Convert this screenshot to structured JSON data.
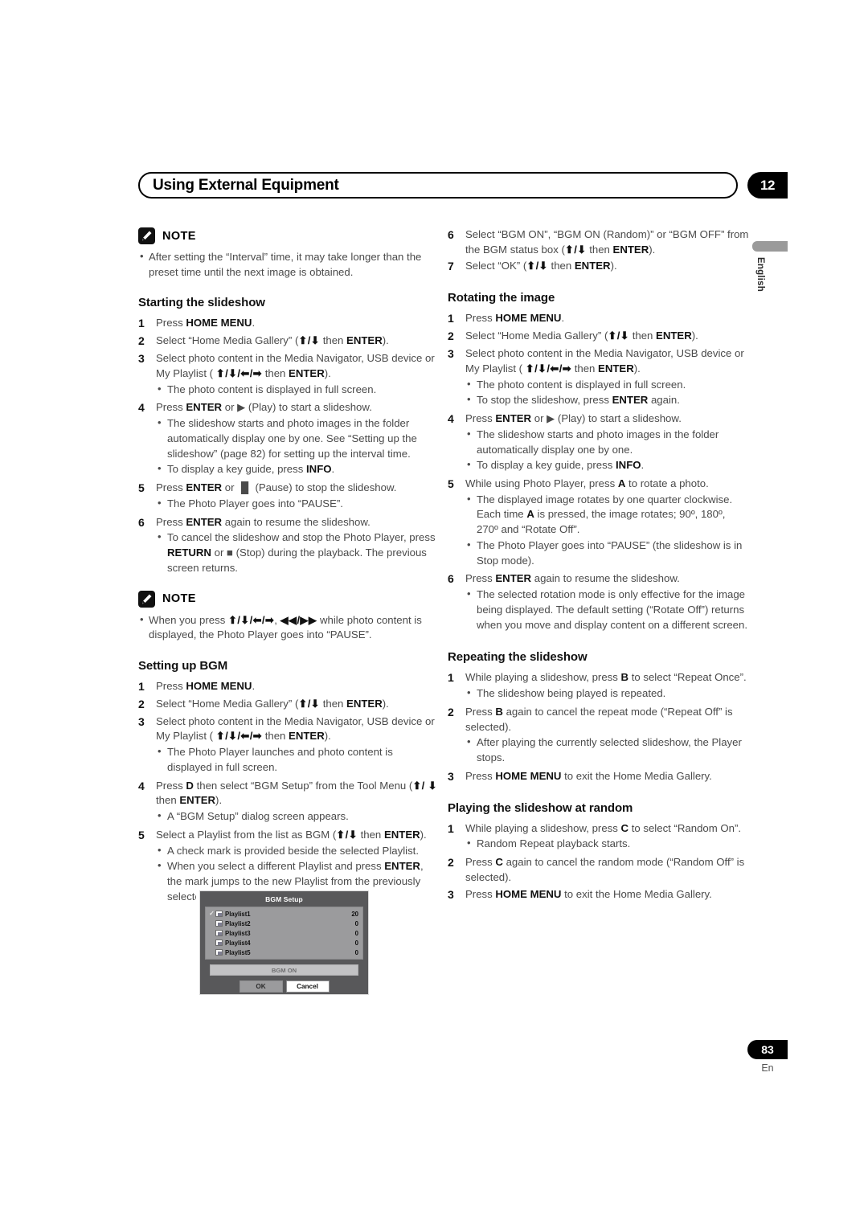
{
  "header": {
    "title": "Using External Equipment",
    "chapter": "12"
  },
  "side": {
    "language": "English"
  },
  "footer": {
    "page_number": "83",
    "language_code": "En"
  },
  "note_label": "NOTE",
  "left_column": {
    "note_top": {
      "label": "NOTE",
      "bullets": [
        "After setting the “Interval” time, it may take longer than the preset time until the next image is obtained."
      ]
    },
    "section_starting": {
      "heading": "Starting the slideshow",
      "steps": [
        {
          "num": "1",
          "text_html": "Press <b>HOME MENU</b>."
        },
        {
          "num": "2",
          "text_html": "Select “Home Media Gallery” (<span class=\"arrows\">⬆/⬇</span> then <b>ENTER</b>)."
        },
        {
          "num": "3",
          "text_html": "Select photo content in the Media Navigator, USB device or My Playlist ( <span class=\"arrows\">⬆/⬇/⬅/➡</span> then <b>ENTER</b>).",
          "bullets_html": [
            "The photo content is displayed in full screen."
          ]
        },
        {
          "num": "4",
          "text_html": "Press <b>ENTER</b> or ▶ (Play) to start a slideshow.",
          "bullets_html": [
            "The slideshow starts and photo images in the folder automatically display one by one. See “Setting up the slideshow” (page 82) for setting up the interval time.",
            "To display a key guide, press <b>INFO</b>."
          ]
        },
        {
          "num": "5",
          "text_html": "Press <b>ENTER</b> or ▐▌ (Pause) to stop the slideshow.",
          "bullets_html": [
            "The Photo Player goes into “PAUSE”."
          ]
        },
        {
          "num": "6",
          "text_html": "Press <b>ENTER</b> again to resume the slideshow.",
          "bullets_html": [
            "To cancel the slideshow and stop the Photo Player, press <b>RETURN</b> or ■ (Stop) during the playback. The previous screen returns."
          ]
        }
      ]
    },
    "note_middle": {
      "label": "NOTE",
      "bullets_html": [
        "When you press <span class=\"arrows\">⬆/⬇/⬅/➡</span>, <span class=\"arrows\">◀◀/▶▶</span> while photo content is displayed, the Photo Player goes into “PAUSE”."
      ]
    },
    "section_bgm": {
      "heading": "Setting up BGM",
      "steps": [
        {
          "num": "1",
          "text_html": "Press <b>HOME MENU</b>."
        },
        {
          "num": "2",
          "text_html": "Select “Home Media Gallery” (<span class=\"arrows\">⬆/⬇</span> then <b>ENTER</b>)."
        },
        {
          "num": "3",
          "text_html": "Select photo content in the Media Navigator, USB device or My Playlist ( <span class=\"arrows\">⬆/⬇/⬅/➡</span> then <b>ENTER</b>).",
          "bullets_html": [
            "The Photo Player launches and photo content is displayed in full screen."
          ]
        },
        {
          "num": "4",
          "text_html": "Press <b>D</b> then select “BGM Setup” from the Tool Menu (<span class=\"arrows\">⬆/ ⬇</span> then <b>ENTER</b>).",
          "bullets_html": [
            "A “BGM Setup” dialog screen appears."
          ]
        },
        {
          "num": "5",
          "text_html": "Select a Playlist from the list as BGM (<span class=\"arrows\">⬆/⬇</span> then <b>ENTER</b>).",
          "bullets_html": [
            "A check mark is provided beside the selected Playlist.",
            "When you select a different Playlist and press <b>ENTER</b>, the mark jumps to the new Playlist from the previously selected one."
          ]
        }
      ]
    }
  },
  "right_column": {
    "continued_steps": [
      {
        "num": "6",
        "text_html": "Select “BGM ON”, “BGM ON (Random)” or “BGM OFF” from the BGM status box (<span class=\"arrows\">⬆/⬇</span> then <b>ENTER</b>)."
      },
      {
        "num": "7",
        "text_html": "Select “OK” (<span class=\"arrows\">⬆/⬇</span> then <b>ENTER</b>)."
      }
    ],
    "section_rotating": {
      "heading": "Rotating the image",
      "steps": [
        {
          "num": "1",
          "text_html": "Press <b>HOME MENU</b>."
        },
        {
          "num": "2",
          "text_html": "Select “Home Media Gallery” (<span class=\"arrows\">⬆/⬇</span> then <b>ENTER</b>)."
        },
        {
          "num": "3",
          "text_html": "Select photo content in the Media Navigator, USB device or My Playlist ( <span class=\"arrows\">⬆/⬇/⬅/➡</span> then <b>ENTER</b>).",
          "bullets_html": [
            "The photo content is displayed in full screen.",
            "To stop the slideshow, press <b>ENTER</b> again."
          ]
        },
        {
          "num": "4",
          "text_html": "Press <b>ENTER</b> or ▶ (Play) to start a slideshow.",
          "bullets_html": [
            "The slideshow starts and photo images in the folder automatically display one by one.",
            "To display a key guide, press <b>INFO</b>."
          ]
        },
        {
          "num": "5",
          "text_html": "While using Photo Player, press <b>A</b> to rotate a photo.",
          "bullets_html": [
            "The displayed image rotates by one quarter clockwise. Each time <b>A</b> is pressed, the image rotates; 90º, 180º, 270º and “Rotate Off”.",
            "The Photo Player goes into “PAUSE” (the slideshow is in Stop mode)."
          ]
        },
        {
          "num": "6",
          "text_html": "Press <b>ENTER</b> again to resume the slideshow.",
          "bullets_html": [
            "The selected rotation mode is only effective for the image being displayed. The default setting (“Rotate Off”) returns when you move and display content on a different screen."
          ]
        }
      ]
    },
    "section_repeating": {
      "heading": "Repeating the slideshow",
      "steps": [
        {
          "num": "1",
          "text_html": "While playing a slideshow, press <b>B</b> to select “Repeat Once”.",
          "bullets_html": [
            "The slideshow being played is repeated."
          ]
        },
        {
          "num": "2",
          "text_html": "Press <b>B</b> again to cancel the repeat mode (“Repeat Off” is selected).",
          "bullets_html": [
            "After playing the currently selected slideshow, the Player stops."
          ]
        },
        {
          "num": "3",
          "text_html": "Press <b>HOME MENU</b> to exit the Home Media Gallery."
        }
      ]
    },
    "section_random": {
      "heading": "Playing the slideshow at random",
      "steps": [
        {
          "num": "1",
          "text_html": "While playing a slideshow, press <b>C</b> to select “Random On”.",
          "bullets_html": [
            "Random Repeat playback starts."
          ]
        },
        {
          "num": "2",
          "text_html": "Press <b>C</b> again to cancel the random mode (“Random Off” is selected)."
        },
        {
          "num": "3",
          "text_html": "Press <b>HOME MENU</b> to exit the Home Media Gallery."
        }
      ]
    }
  },
  "bgm_dialog": {
    "title": "BGM Setup",
    "rows": [
      {
        "checked": true,
        "name": "Playlist1",
        "count": "20"
      },
      {
        "checked": false,
        "name": "Playlist2",
        "count": "0"
      },
      {
        "checked": false,
        "name": "Playlist3",
        "count": "0"
      },
      {
        "checked": false,
        "name": "Playlist4",
        "count": "0"
      },
      {
        "checked": false,
        "name": "Playlist5",
        "count": "0"
      }
    ],
    "status": "BGM ON",
    "ok_label": "OK",
    "cancel_label": "Cancel"
  }
}
